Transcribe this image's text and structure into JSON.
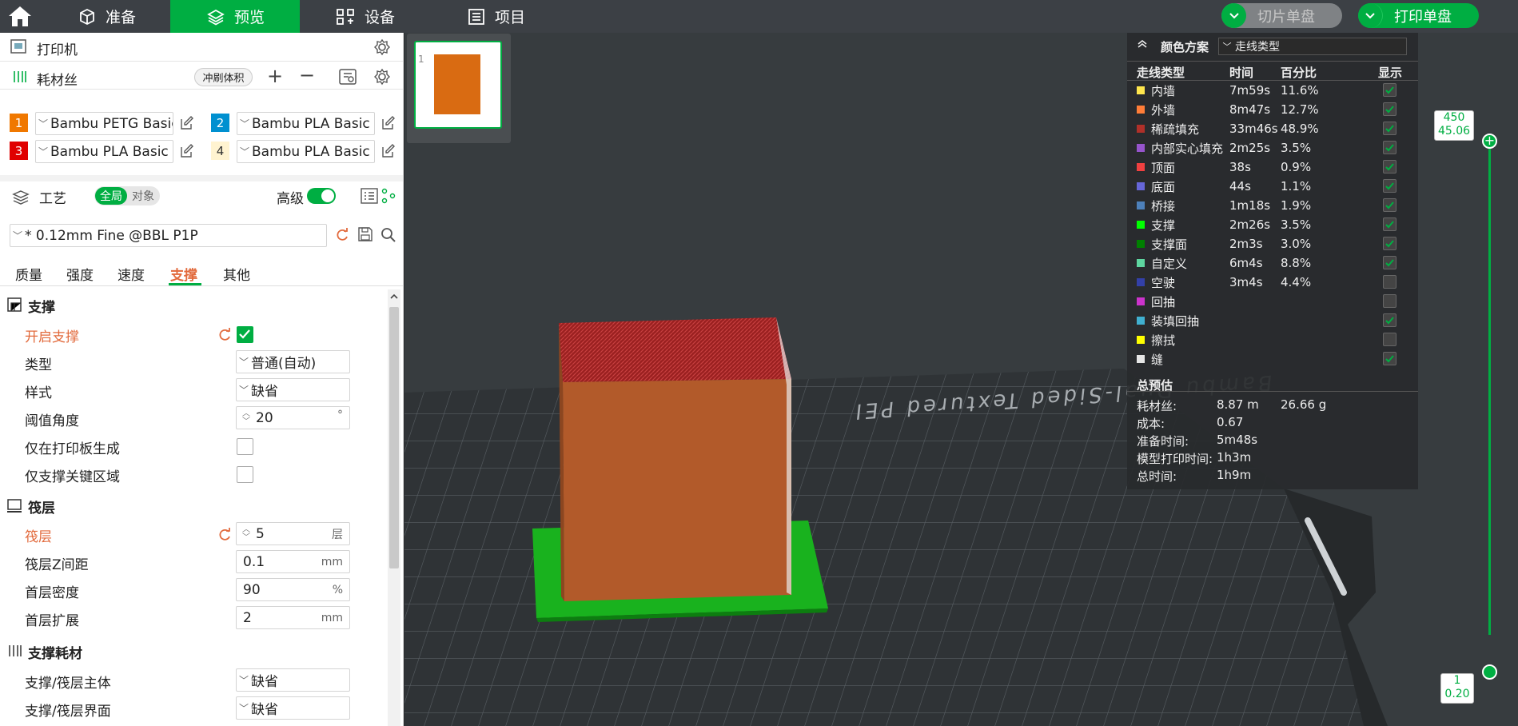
{
  "topbar": {
    "tabs": [
      {
        "label": "准备"
      },
      {
        "label": "预览"
      },
      {
        "label": "设备"
      },
      {
        "label": "项目"
      }
    ],
    "slice_plate": "切片单盘",
    "print_plate": "打印单盘",
    "brand_color": "#00ae42"
  },
  "printer": {
    "label": "打印机"
  },
  "filament": {
    "label": "耗材丝",
    "flush_volume": "冲刷体积",
    "slots": [
      {
        "num": "1",
        "name": "Bambu PETG Basic",
        "color": "#f07800"
      },
      {
        "num": "2",
        "name": "Bambu PLA Basic",
        "color": "#0090d0"
      },
      {
        "num": "3",
        "name": "Bambu PLA Basic",
        "color": "#e00000"
      },
      {
        "num": "4",
        "name": "Bambu PLA Basic",
        "color": "#fff3d0"
      }
    ]
  },
  "process": {
    "label": "工艺",
    "toggle_global": "全局",
    "toggle_object": "对象",
    "advanced": "高级",
    "profile": "* 0.12mm Fine @BBL P1P",
    "tabs": [
      "质量",
      "强度",
      "速度",
      "支撑",
      "其他"
    ]
  },
  "support": {
    "title": "支撑",
    "enable": "开启支撑",
    "type_label": "类型",
    "type_value": "普通(自动)",
    "style_label": "样式",
    "style_value": "缺省",
    "threshold_label": "阈值角度",
    "threshold_value": "20",
    "threshold_unit": "°",
    "on_plate_label": "仅在打印板生成",
    "critical_label": "仅支撑关键区域"
  },
  "raft": {
    "title": "筏层",
    "layers_label": "筏层",
    "layers_value": "5",
    "layers_unit": "层",
    "z_label": "筏层Z间距",
    "z_value": "0.1",
    "z_unit": "mm",
    "density_label": "首层密度",
    "density_value": "90",
    "density_unit": "%",
    "expand_label": "首层扩展",
    "expand_value": "2",
    "expand_unit": "mm"
  },
  "support_filament": {
    "title": "支撑耗材",
    "base_label": "支撑/筏层主体",
    "base_value": "缺省",
    "iface_label": "支撑/筏层界面",
    "iface_value": "缺省"
  },
  "legend": {
    "title": "颜色方案",
    "scheme": "走线类型",
    "headers": [
      "走线类型",
      "时间",
      "百分比",
      "显示"
    ],
    "rows": [
      {
        "name": "内墙",
        "time": "7m59s",
        "pct": "11.6%",
        "color": "#ffe64d",
        "shown": true
      },
      {
        "name": "外墙",
        "time": "8m47s",
        "pct": "12.7%",
        "color": "#ff7d38",
        "shown": true
      },
      {
        "name": "稀疏填充",
        "time": "33m46s",
        "pct": "48.9%",
        "color": "#b03029",
        "shown": true
      },
      {
        "name": "内部实心填充",
        "time": "2m25s",
        "pct": "3.5%",
        "color": "#9654cc",
        "shown": true
      },
      {
        "name": "顶面",
        "time": "38s",
        "pct": "0.9%",
        "color": "#f04040",
        "shown": true
      },
      {
        "name": "底面",
        "time": "44s",
        "pct": "1.1%",
        "color": "#6666d9",
        "shown": true
      },
      {
        "name": "桥接",
        "time": "1m18s",
        "pct": "1.9%",
        "color": "#4d80ba",
        "shown": true
      },
      {
        "name": "支撑",
        "time": "2m26s",
        "pct": "3.5%",
        "color": "#00ff00",
        "shown": true
      },
      {
        "name": "支撑面",
        "time": "2m3s",
        "pct": "3.0%",
        "color": "#008000",
        "shown": true
      },
      {
        "name": "自定义",
        "time": "6m4s",
        "pct": "8.8%",
        "color": "#5ed6a0",
        "shown": true
      },
      {
        "name": "空驶",
        "time": "3m4s",
        "pct": "4.4%",
        "color": "#3340a8",
        "shown": false
      },
      {
        "name": "回抽",
        "time": "",
        "pct": "",
        "color": "#cc33cc",
        "shown": false
      },
      {
        "name": "装填回抽",
        "time": "",
        "pct": "",
        "color": "#40b0d0",
        "shown": true
      },
      {
        "name": "擦拭",
        "time": "",
        "pct": "",
        "color": "#ffff00",
        "shown": false
      },
      {
        "name": "缝",
        "time": "",
        "pct": "",
        "color": "#e6e6e6",
        "shown": true
      }
    ],
    "estimate_title": "总预估",
    "filament_label": "耗材丝:",
    "filament_len": "8.87 m",
    "filament_weight": "26.66 g",
    "cost_label": "成本:",
    "cost_value": "0.67",
    "prep_label": "准备时间:",
    "prep_value": "5m48s",
    "model_label": "模型打印时间:",
    "model_value": "1h3m",
    "total_label": "总时间:",
    "total_value": "1h9m"
  },
  "layer_slider": {
    "top_layer": "450",
    "top_height": "45.06",
    "bottom_layer": "1",
    "bottom_height": "0.20"
  },
  "thumbnail": {
    "index": "1"
  },
  "bed_text": "Bambu Dual-Sided Textured PEI"
}
